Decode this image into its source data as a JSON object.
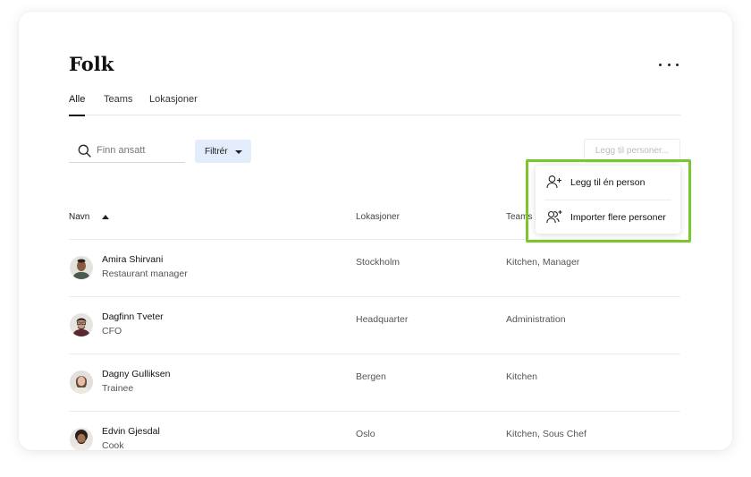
{
  "page": {
    "title": "Folk"
  },
  "tabs": [
    {
      "label": "Alle",
      "active": true
    },
    {
      "label": "Teams",
      "active": false
    },
    {
      "label": "Lokasjoner",
      "active": false
    }
  ],
  "toolbar": {
    "search_placeholder": "Finn ansatt",
    "filter_label": "Filtrér",
    "add_label": "Legg til personer..."
  },
  "table": {
    "headers": {
      "name": "Navn",
      "location": "Lokasjoner",
      "teams": "Teams"
    },
    "rows": [
      {
        "name": "Amira Shirvani",
        "role": "Restaurant manager",
        "location": "Stockholm",
        "teams": "Kitchen, Manager"
      },
      {
        "name": "Dagfinn Tveter",
        "role": "CFO",
        "location": "Headquarter",
        "teams": "Administration"
      },
      {
        "name": "Dagny Gulliksen",
        "role": "Trainee",
        "location": "Bergen",
        "teams": "Kitchen"
      },
      {
        "name": "Edvin Gjesdal",
        "role": "Cook",
        "location": "Oslo",
        "teams": "Kitchen, Sous Chef"
      }
    ]
  },
  "add_menu": {
    "items": [
      {
        "label": "Legg til én person",
        "icon": "user-plus-icon"
      },
      {
        "label": "Importer flere personer",
        "icon": "users-plus-icon"
      }
    ]
  },
  "colors": {
    "highlight": "#7bc62d",
    "filter_bg": "#e2ecfb"
  }
}
